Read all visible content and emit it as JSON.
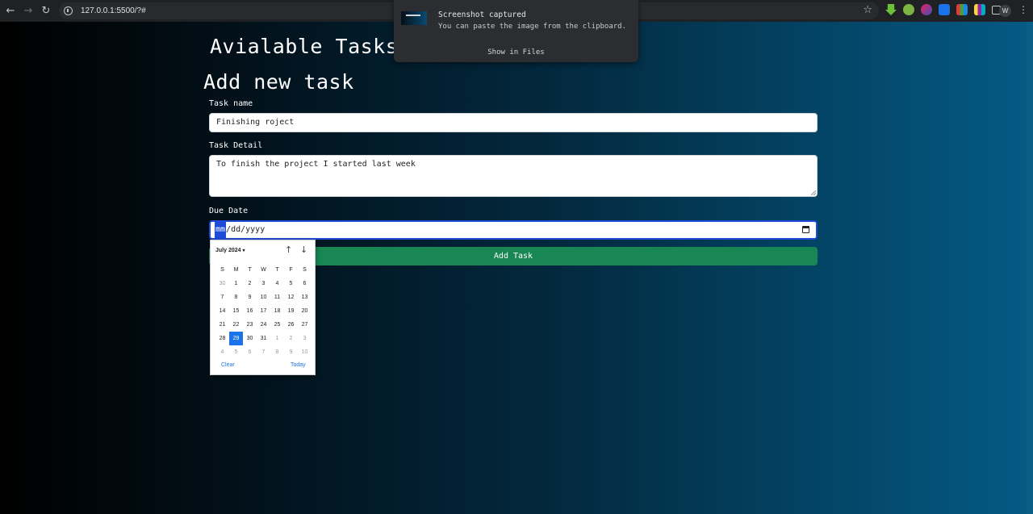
{
  "browser": {
    "url": "127.0.0.1:5500/?#",
    "back_icon": "←",
    "forward_icon": "→",
    "reload_icon": "↻",
    "star_icon": "☆",
    "profile_initial": "W",
    "menu_icon": "⋮"
  },
  "page": {
    "available_title": "Avialable Tasks",
    "add_title": "Add new task"
  },
  "form": {
    "task_name_label": "Task name",
    "task_name_value": "Finishing roject",
    "task_detail_label": "Task Detail",
    "task_detail_value": "To finish the project I started last week",
    "due_date_label": "Due Date",
    "due_date_mm": "mm",
    "due_date_rest": "/dd/yyyy",
    "submit_label": "Add Task",
    "accent_color": "#198754"
  },
  "datepicker": {
    "month_label": "July 2024",
    "caret": "▾",
    "prev_icon": "↑",
    "next_icon": "↓",
    "weekdays": [
      "S",
      "M",
      "T",
      "W",
      "T",
      "F",
      "S"
    ],
    "weeks": [
      [
        "30",
        "1",
        "2",
        "3",
        "4",
        "5",
        "6"
      ],
      [
        "7",
        "8",
        "9",
        "10",
        "11",
        "12",
        "13"
      ],
      [
        "14",
        "15",
        "16",
        "17",
        "18",
        "19",
        "20"
      ],
      [
        "21",
        "22",
        "23",
        "24",
        "25",
        "26",
        "27"
      ],
      [
        "28",
        "29",
        "30",
        "31",
        "1",
        "2",
        "3"
      ],
      [
        "4",
        "5",
        "6",
        "7",
        "8",
        "9",
        "10"
      ]
    ],
    "selected_day": "29",
    "clear_label": "Clear",
    "today_label": "Today",
    "selected_color": "#1a73e8"
  },
  "notification": {
    "title": "Screenshot captured",
    "body": "You can paste the image from the clipboard.",
    "action": "Show in Files"
  }
}
